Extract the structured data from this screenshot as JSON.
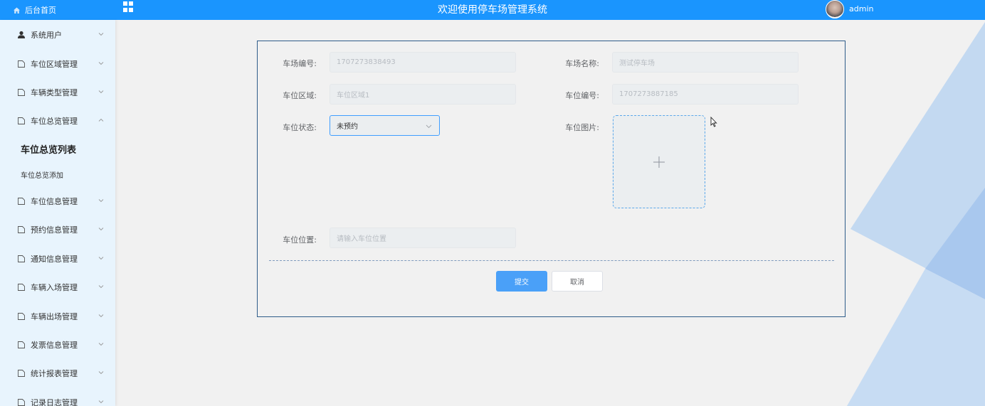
{
  "header": {
    "home_label": "后台首页",
    "title": "欢迎使用停车场管理系统",
    "username": "admin"
  },
  "sidebar": {
    "items": [
      {
        "label": "系统用户"
      },
      {
        "label": "车位区域管理"
      },
      {
        "label": "车辆类型管理"
      },
      {
        "label": "车位总览管理"
      },
      {
        "label": "车位信息管理"
      },
      {
        "label": "预约信息管理"
      },
      {
        "label": "通知信息管理"
      },
      {
        "label": "车辆入场管理"
      },
      {
        "label": "车辆出场管理"
      },
      {
        "label": "发票信息管理"
      },
      {
        "label": "统计报表管理"
      },
      {
        "label": "记录日志管理"
      }
    ],
    "subitems": [
      {
        "label": "车位总览列表"
      },
      {
        "label": "车位总览添加"
      }
    ]
  },
  "form": {
    "lot_number_label": "车场编号:",
    "lot_number_value": "1707273838493",
    "lot_name_label": "车场名称:",
    "lot_name_value": "测试停车场",
    "area_label": "车位区域:",
    "area_value": "车位区域1",
    "space_number_label": "车位编号:",
    "space_number_value": "1707273887185",
    "status_label": "车位状态:",
    "status_value": "未预约",
    "image_label": "车位图片:",
    "location_label": "车位位置:",
    "location_placeholder": "请输入车位位置",
    "submit_label": "提交",
    "cancel_label": "取消"
  },
  "colors": {
    "header_bg": "#1a95fe",
    "sidebar_bg": "#e8f4fd",
    "primary": "#4aa0f8",
    "card_border": "#2f5c89"
  }
}
